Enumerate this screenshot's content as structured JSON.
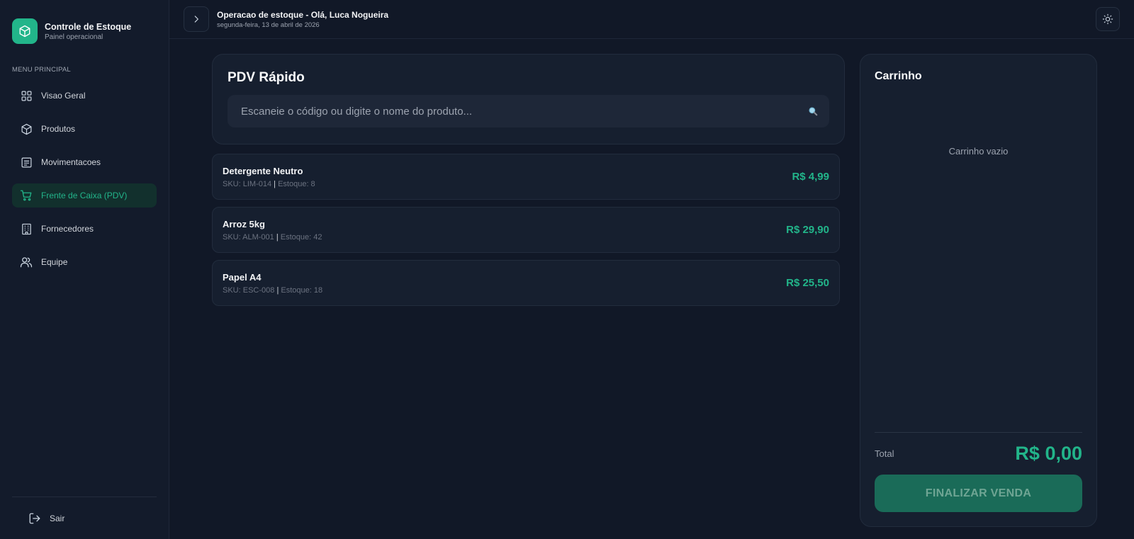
{
  "brand": {
    "title": "Controle de Estoque",
    "subtitle": "Painel operacional",
    "logo_icon": "box-icon",
    "accent_color": "#22b58a"
  },
  "sidebar": {
    "section_label": "MENU PRINCIPAL",
    "items": [
      {
        "label": "Visao Geral",
        "icon": "grid-icon",
        "active": false
      },
      {
        "label": "Produtos",
        "icon": "box-icon",
        "active": false
      },
      {
        "label": "Movimentacoes",
        "icon": "list-icon",
        "active": false
      },
      {
        "label": "Frente de Caixa (PDV)",
        "icon": "cart-icon",
        "active": true
      },
      {
        "label": "Fornecedores",
        "icon": "building-icon",
        "active": false
      },
      {
        "label": "Equipe",
        "icon": "users-icon",
        "active": false
      }
    ],
    "logout_label": "Sair"
  },
  "topbar": {
    "title": "Operacao de estoque - Olá, Luca Nogueira",
    "date": "segunda-feira, 13 de abril de 2026"
  },
  "pdv": {
    "title": "PDV Rápido",
    "search_placeholder": "Escaneie o código ou digite o nome do produto..."
  },
  "products": [
    {
      "name": "Detergente Neutro",
      "sku": "SKU: LIM-014",
      "stock": "Estoque: 8",
      "price": "R$ 4,99"
    },
    {
      "name": "Arroz 5kg",
      "sku": "SKU: ALM-001",
      "stock": "Estoque: 42",
      "price": "R$ 29,90"
    },
    {
      "name": "Papel A4",
      "sku": "SKU: ESC-008",
      "stock": "Estoque: 18",
      "price": "R$ 25,50"
    }
  ],
  "cart": {
    "title": "Carrinho",
    "empty_text": "Carrinho vazio",
    "total_label": "Total",
    "total_value": "R$ 0,00",
    "finalize_label": "FINALIZAR VENDA"
  }
}
